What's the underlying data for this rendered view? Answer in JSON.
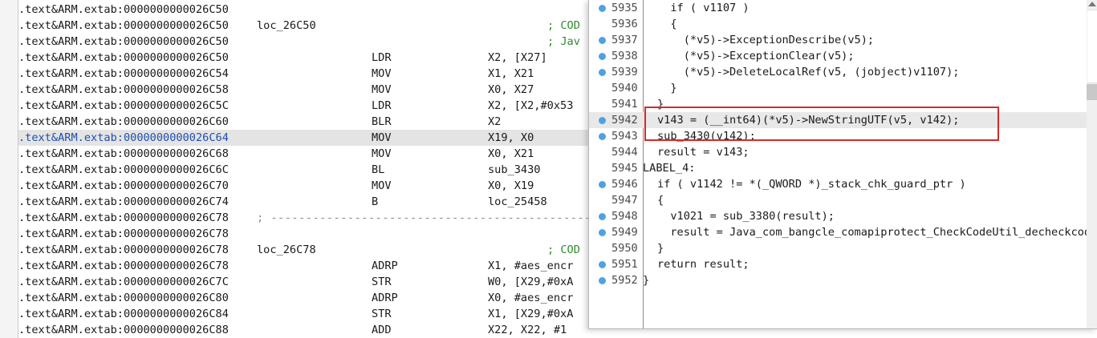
{
  "disassembly": {
    "lines": [
      {
        "addr": ".text&ARM.extab:0000000000026C50",
        "label": "",
        "mnem": "",
        "ops": "",
        "comment": ""
      },
      {
        "addr": ".text&ARM.extab:0000000000026C50",
        "label": "loc_26C50",
        "mnem": "",
        "ops": "",
        "comment": "; COD"
      },
      {
        "addr": ".text&ARM.extab:0000000000026C50",
        "label": "",
        "mnem": "",
        "ops": "",
        "comment": "; Jav"
      },
      {
        "addr": ".text&ARM.extab:0000000000026C50",
        "label": "",
        "mnem": "LDR",
        "ops": "X2, [X27]",
        "comment": ""
      },
      {
        "addr": ".text&ARM.extab:0000000000026C54",
        "label": "",
        "mnem": "MOV",
        "ops": "X1, X21",
        "comment": ""
      },
      {
        "addr": ".text&ARM.extab:0000000000026C58",
        "label": "",
        "mnem": "MOV",
        "ops": "X0, X27",
        "comment": ""
      },
      {
        "addr": ".text&ARM.extab:0000000000026C5C",
        "label": "",
        "mnem": "LDR",
        "ops": "X2, [X2,#0x53",
        "comment": ""
      },
      {
        "addr": ".text&ARM.extab:0000000000026C60",
        "label": "",
        "mnem": "BLR",
        "ops": "X2",
        "comment": ""
      },
      {
        "addr": ".text&ARM.extab:0000000000026C64",
        "label": "",
        "mnem": "MOV",
        "ops": "X19, X0",
        "comment": "",
        "selected": true
      },
      {
        "addr": ".text&ARM.extab:0000000000026C68",
        "label": "",
        "mnem": "MOV",
        "ops": "X0, X21",
        "comment": ""
      },
      {
        "addr": ".text&ARM.extab:0000000000026C6C",
        "label": "",
        "mnem": "BL",
        "ops": "sub_3430",
        "comment": ""
      },
      {
        "addr": ".text&ARM.extab:0000000000026C70",
        "label": "",
        "mnem": "MOV",
        "ops": "X0, X19",
        "comment": ""
      },
      {
        "addr": ".text&ARM.extab:0000000000026C74",
        "label": "",
        "mnem": "B",
        "ops": "loc_25458",
        "comment": ""
      },
      {
        "addr": ".text&ARM.extab:0000000000026C78",
        "label": "",
        "mnem": "",
        "ops": "",
        "comment": "",
        "separator": "; ---------------------------------------------------------------"
      },
      {
        "addr": ".text&ARM.extab:0000000000026C78",
        "label": "",
        "mnem": "",
        "ops": "",
        "comment": ""
      },
      {
        "addr": ".text&ARM.extab:0000000000026C78",
        "label": "loc_26C78",
        "mnem": "",
        "ops": "",
        "comment": "; COD"
      },
      {
        "addr": ".text&ARM.extab:0000000000026C78",
        "label": "",
        "mnem": "ADRP",
        "ops": "X1, #aes_encr",
        "comment": ""
      },
      {
        "addr": ".text&ARM.extab:0000000000026C7C",
        "label": "",
        "mnem": "STR",
        "ops": "W0, [X29,#0xA",
        "comment": ""
      },
      {
        "addr": ".text&ARM.extab:0000000000026C80",
        "label": "",
        "mnem": "ADRP",
        "ops": "X0, #aes_encr",
        "comment": ""
      },
      {
        "addr": ".text&ARM.extab:0000000000026C84",
        "label": "",
        "mnem": "STR",
        "ops": "X1, [X29,#0xA",
        "comment": ""
      },
      {
        "addr": ".text&ARM.extab:0000000000026C88",
        "label": "",
        "mnem": "ADD",
        "ops": "X22, X22, #1",
        "comment": ""
      }
    ]
  },
  "pseudocode": {
    "lines": [
      {
        "num": "5935",
        "bp": true,
        "code": "  if ( v1107 )"
      },
      {
        "num": "5936",
        "bp": false,
        "code": "  {"
      },
      {
        "num": "5937",
        "bp": true,
        "code": "    (*v5)->ExceptionDescribe(v5);"
      },
      {
        "num": "5938",
        "bp": true,
        "code": "    (*v5)->ExceptionClear(v5);"
      },
      {
        "num": "5939",
        "bp": true,
        "code": "    (*v5)->DeleteLocalRef(v5, (jobject)v1107);"
      },
      {
        "num": "5940",
        "bp": false,
        "code": "  }"
      },
      {
        "num": "5941",
        "bp": false,
        "code": "}"
      },
      {
        "num": "5942",
        "bp": true,
        "code": "v143 = (__int64)(*v5)->NewStringUTF(v5, v142);",
        "current": true
      },
      {
        "num": "5943",
        "bp": true,
        "code": "sub_3430(v142);"
      },
      {
        "num": "5944",
        "bp": false,
        "code": "result = v143;"
      },
      {
        "num": "5945",
        "bp": false,
        "code": "LABEL_4:",
        "label": true
      },
      {
        "num": "5946",
        "bp": true,
        "code": "if ( v1142 != *(_QWORD *)_stack_chk_guard_ptr )"
      },
      {
        "num": "5947",
        "bp": false,
        "code": "{"
      },
      {
        "num": "5948",
        "bp": true,
        "code": "  v1021 = sub_3380(result);"
      },
      {
        "num": "5949",
        "bp": true,
        "code": "  result = Java_com_bangcle_comapiprotect_CheckCodeUtil_decheckcode"
      },
      {
        "num": "5950",
        "bp": false,
        "code": "}"
      },
      {
        "num": "5951",
        "bp": true,
        "code": "return result;"
      },
      {
        "num": "5952",
        "bp": true,
        "code": "}",
        "label": true
      }
    ]
  }
}
